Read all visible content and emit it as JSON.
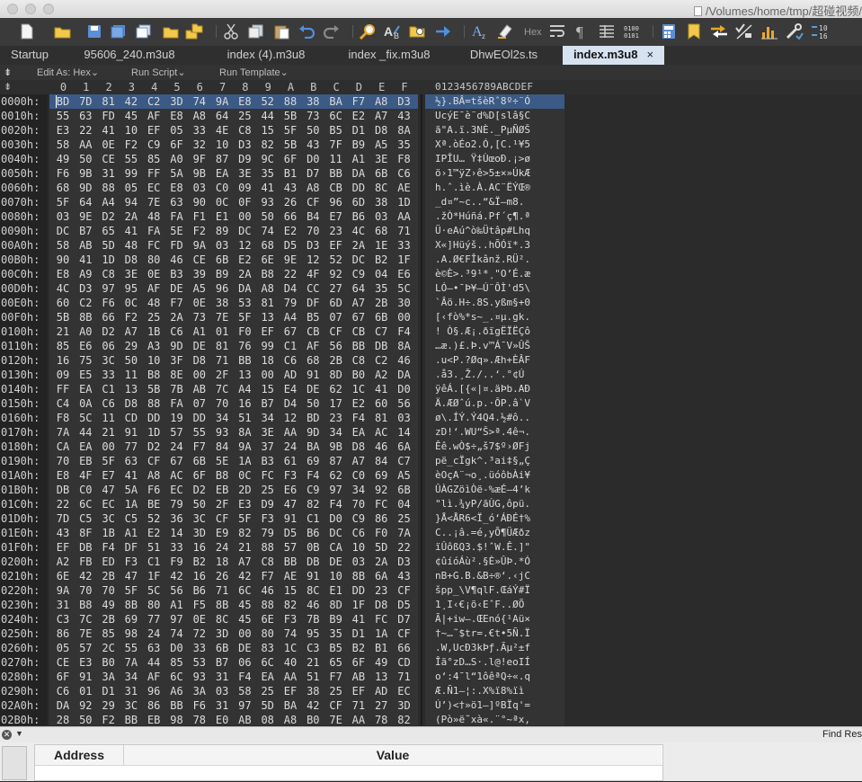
{
  "window": {
    "title": "/Volumes/home/tmp/超碰视频/"
  },
  "toolbar": {
    "icons": [
      "new-document-icon",
      "open-folder-icon",
      "save-icon",
      "save-all-icon",
      "copy-files-icon",
      "folder-icon",
      "folder-tree-icon",
      "cut-icon",
      "copy-icon",
      "paste-icon",
      "undo-icon",
      "redo-icon",
      "find-icon",
      "replace-icon",
      "find-in-files-icon",
      "goto-icon",
      "font-icon",
      "highlight-icon",
      "hex-toggle-icon",
      "word-wrap-icon",
      "paragraph-icon",
      "columns-icon",
      "binary-icon",
      "calculator-icon",
      "bookmark-icon",
      "compare-icon",
      "checksum-icon",
      "statistics-icon",
      "tools-icon",
      "convert-icon"
    ],
    "hex_label": "Hex",
    "binary_label": "0100\n0101",
    "convert_label": "10\n16"
  },
  "tabs": [
    {
      "label": "Startup",
      "active": false
    },
    {
      "label": "95606_240.m3u8",
      "active": false
    },
    {
      "label": "index (4).m3u8",
      "active": false
    },
    {
      "label": "index _fix.m3u8",
      "active": false
    },
    {
      "label": "DhwEOl2s.ts",
      "active": false
    },
    {
      "label": "index.m3u8",
      "active": true
    }
  ],
  "tab_close": "×",
  "subbar": {
    "collapse_glyph": "⇟",
    "edit_as": "Edit As: Hex",
    "run_script": "Run Script",
    "run_template": "Run Template",
    "chevron": "⌄"
  },
  "hex_header": {
    "corner": "⇟",
    "columns": [
      "0",
      "1",
      "2",
      "3",
      "4",
      "5",
      "6",
      "7",
      "8",
      "9",
      "A",
      "B",
      "C",
      "D",
      "E",
      "F"
    ],
    "ascii_header": "0123456789ABCDEF"
  },
  "rows": [
    {
      "addr": "0000h:",
      "hex": "BD 7D 81 42 C2 3D 74 9A E8 52 88 38 BA F7 A8 D3",
      "ascii": "½}.BÂ=tšèRˆ8º÷¨Ó"
    },
    {
      "addr": "0010h:",
      "hex": "55 63 FD 45 AF E8 A8 64 25 44 5B 73 6C E2 A7 43",
      "ascii": "UcýE¯è¨d%D[slâ§C"
    },
    {
      "addr": "0020h:",
      "hex": "E3 22 41 10 EF 05 33 4E C8 15 5F 50 B5 D1 D8 8A",
      "ascii": "ã\"A.ï.3NÈ._PµÑØŠ"
    },
    {
      "addr": "0030h:",
      "hex": "58 AA 0E F2 C9 6F 32 10 D3 82 5B 43 7F B9 A5 35",
      "ascii": "Xª.òÉo2.Ó‚[C.¹¥5"
    },
    {
      "addr": "0040h:",
      "hex": "49 50 CE 55 85 A0 9F 87 D9 9C 6F D0 11 A1 3E F8",
      "ascii": "IPÎU… Ÿ‡ÙœoÐ.¡>ø"
    },
    {
      "addr": "0050h:",
      "hex": "F6 9B 31 99 FF 5A 9B EA 3E 35 B1 D7 BB DA 6B C6",
      "ascii": "ö›1™ÿZ›ê>5±×»ÚkÆ"
    },
    {
      "addr": "0060h:",
      "hex": "68 9D 88 05 EC E8 03 C0 09 41 43 A8 CB DD 8C AE",
      "ascii": "h.ˆ.ìè.À.AC¨ËÝŒ®"
    },
    {
      "addr": "0070h:",
      "hex": "5F 64 A4 94 7E 63 90 0C 0F 93 26 CF 96 6D 38 1D",
      "ascii": "_d¤”~c..“&Ï–m8."
    },
    {
      "addr": "0080h:",
      "hex": "03 9E D2 2A 48 FA F1 E1 00 50 66 B4 E7 B6 03 AA",
      "ascii": ".žÒ*Húñá.Pf´ç¶.ª"
    },
    {
      "addr": "0090h:",
      "hex": "DC B7 65 41 FA 5E F2 89 DC 74 E2 70 23 4C 68 71",
      "ascii": "Ü·eAú^ò‰Ütâp#Lhq"
    },
    {
      "addr": "00A0h:",
      "hex": "58 AB 5D 48 FC FD 9A 03 12 68 D5 D3 EF 2A 1E 33",
      "ascii": "X«]Hüýš..hÕÓï*.3"
    },
    {
      "addr": "00B0h:",
      "hex": "90 41 1D D8 80 46 CE 6B E2 6E 9E 12 52 DC B2 1F",
      "ascii": ".A.Ø€FÎkânž.RÜ²."
    },
    {
      "addr": "00C0h:",
      "hex": "E8 A9 C8 3E 0E B3 39 B9 2A B8 22 4F 92 C9 04 E6",
      "ascii": "è©È>.³9¹*¸\"O’É.æ"
    },
    {
      "addr": "00D0h:",
      "hex": "4C D3 97 95 AF DE A5 96 DA A8 D4 CC 27 64 35 5C",
      "ascii": "LÓ—•¯Þ¥–Ú¨ÔÌ'd5\\"
    },
    {
      "addr": "00E0h:",
      "hex": "60 C2 F6 0C 48 F7 0E 38 53 81 79 DF 6D A7 2B 30",
      "ascii": "`Âö.H÷.8S.yßm§+0"
    },
    {
      "addr": "00F0h:",
      "hex": "5B 8B 66 F2 25 2A 73 7E 5F 13 A4 B5 07 67 6B 00",
      "ascii": "[‹fò%*s~_.¤µ.gk."
    },
    {
      "addr": "0100h:",
      "hex": "21 A0 D2 A7 1B C6 A1 01 F0 EF 67 CB CF CB C7 F4",
      "ascii": "! Ò§.Æ¡.ðïgËÏËÇô"
    },
    {
      "addr": "0110h:",
      "hex": "85 E6 06 29 A3 9D DE 81 76 99 C1 AF 56 BB DB 8A",
      "ascii": "…æ.)£.Þ.v™Á¯V»ÛŠ"
    },
    {
      "addr": "0120h:",
      "hex": "16 75 3C 50 10 3F D8 71 BB 18 C6 68 2B C8 C2 46",
      "ascii": ".u<P.?Øq».Æh+ÈÂF"
    },
    {
      "addr": "0130h:",
      "hex": "09 E5 33 11 B8 8E 00 2F 13 00 AD 91 8D B0 A2 DA",
      "ascii": ".å3.¸Ž./..­‘.°¢Ú"
    },
    {
      "addr": "0140h:",
      "hex": "FF EA C1 13 5B 7B AB 7C A4 15 E4 DE 62 1C 41 D0",
      "ascii": "ÿêÁ.[{«|¤.äÞb.AÐ"
    },
    {
      "addr": "0150h:",
      "hex": "C4 0A C6 D8 88 FA 07 70 16 B7 D4 50 17 E2 60 56",
      "ascii": "Ä.ÆØˆú.p.·ÔP.â`V"
    },
    {
      "addr": "0160h:",
      "hex": "F8 5C 11 CD DD 19 DD 34 51 34 12 BD 23 F4 81 03",
      "ascii": "ø\\.ÍÝ.Ý4Q4.½#ô.."
    },
    {
      "addr": "0170h:",
      "hex": "7A 44 21 91 1D 57 55 93 8A 3E AA 9D 34 EA AC 14",
      "ascii": "zD!‘.WU“Š>ª.4ê¬."
    },
    {
      "addr": "0180h:",
      "hex": "CA EA 00 77 D2 24 F7 84 9A 37 24 BA 9B D8 46 6A",
      "ascii": "Êê.wÒ$÷„š7$º›ØFj"
    },
    {
      "addr": "0190h:",
      "hex": "70 EB 5F 63 CF 67 6B 5E 1A B3 61 69 87 A7 84 C7",
      "ascii": "pë_cÏgk^.³ai‡§„Ç"
    },
    {
      "addr": "01A0h:",
      "hex": "E8 4F E7 41 A8 AC 6F B8 0C FC F3 F4 62 C0 69 A5",
      "ascii": "èOçA¨¬o¸.üóôbÀi¥"
    },
    {
      "addr": "01B0h:",
      "hex": "DB C0 47 5A F6 EC D2 EB 2D 25 E6 C9 97 34 92 6B",
      "ascii": "ÛÀGZöìÒë-%æÉ—4’k"
    },
    {
      "addr": "01C0h:",
      "hex": "22 6C EC 1A BE 79 50 2F E3 D9 47 82 F4 70 FC 04",
      "ascii": "\"lì.¾yP/ãÙG‚ôpü."
    },
    {
      "addr": "01D0h:",
      "hex": "7D C5 3C C5 52 36 3C CF 5F F3 91 C1 D0 C9 86 25",
      "ascii": "}Å<ÅR6<Ï_ó‘ÁÐÉ†%"
    },
    {
      "addr": "01E0h:",
      "hex": "43 8F 1B A1 E2 14 3D E9 82 79 D5 B6 DC C6 F0 7A",
      "ascii": "C..¡â.=é‚yÕ¶ÜÆðz"
    },
    {
      "addr": "01F0h:",
      "hex": "EF DB F4 DF 51 33 16 24 21 88 57 0B CA 10 5D 22",
      "ascii": "ïÛôßQ3.$!ˆW.Ê.]\""
    },
    {
      "addr": "0200h:",
      "hex": "A2 FB ED F3 C1 F9 B2 18 A7 C8 BB DB DE 03 2A D3",
      "ascii": "¢ûíóÁù².§È»ÛÞ.*Ó"
    },
    {
      "addr": "0210h:",
      "hex": "6E 42 2B 47 1F 42 16 26 42 F7 AE 91 10 8B 6A 43",
      "ascii": "nB+G.B.&B÷®‘.‹jC"
    },
    {
      "addr": "0220h:",
      "hex": "9A 70 70 5F 5C 56 B6 71 6C 46 15 8C E1 DD 23 CF",
      "ascii": "špp_\\V¶qlF.ŒáÝ#Ï"
    },
    {
      "addr": "0230h:",
      "hex": "31 B8 49 8B 80 A1 F5 8B 45 88 82 46 8D 1F D8 D5",
      "ascii": "1¸I‹€¡õ‹EˆF..ØÕ"
    },
    {
      "addr": "0240h:",
      "hex": "C3 7C 2B 69 77 97 0E 8C 45 6E F3 7B B9 41 FC D7",
      "ascii": "Ã|+iw—.ŒEnó{¹Aü×"
    },
    {
      "addr": "0250h:",
      "hex": "86 7E 85 98 24 74 72 3D 00 80 74 95 35 D1 1A CF",
      "ascii": "†~…˜$tr=.€t•5Ñ.Ï"
    },
    {
      "addr": "0260h:",
      "hex": "05 57 2C 55 63 D0 33 6B DE 83 1C C3 B5 B2 B1 66",
      "ascii": ".W,UcÐ3kÞƒ.Ãµ²±f"
    },
    {
      "addr": "0270h:",
      "hex": "CE E3 B0 7A 44 85 53 B7 06 6C 40 21 65 6F 49 CD",
      "ascii": "Îã°zD…S·.l@!eoIÍ"
    },
    {
      "addr": "0280h:",
      "hex": "6F 91 3A 34 AF 6C 93 31 F4 EA AA 51 F7 AB 13 71",
      "ascii": "o‘:4¯l“1ôêªQ÷«.q"
    },
    {
      "addr": "0290h:",
      "hex": "C6 01 D1 31 96 A6 3A 03 58 25 EF 38 25 EF AD EC",
      "ascii": "Æ.Ñ1–¦:.X%ï8%ï­ì"
    },
    {
      "addr": "02A0h:",
      "hex": "DA 92 29 3C 86 BB F6 31 97 5D BA 42 CF 71 27 3D",
      "ascii": "Ú’)<†»ö1—]ºBÏq'="
    },
    {
      "addr": "02B0h:",
      "hex": "28 50 F2 BB EB 98 78 E0 AB 08 A8 B0 7E AA 78 82",
      "ascii": "(Pò»ë˜xà«.¨°~ªx‚"
    }
  ],
  "bottom_panel": {
    "find_results": "Find Res",
    "close_glyph": "✕",
    "caret": "▼",
    "headers": {
      "address": "Address",
      "value": "Value"
    }
  },
  "colors": {
    "selection": "#3b5a86",
    "active_tab": "#d7e2f0"
  }
}
